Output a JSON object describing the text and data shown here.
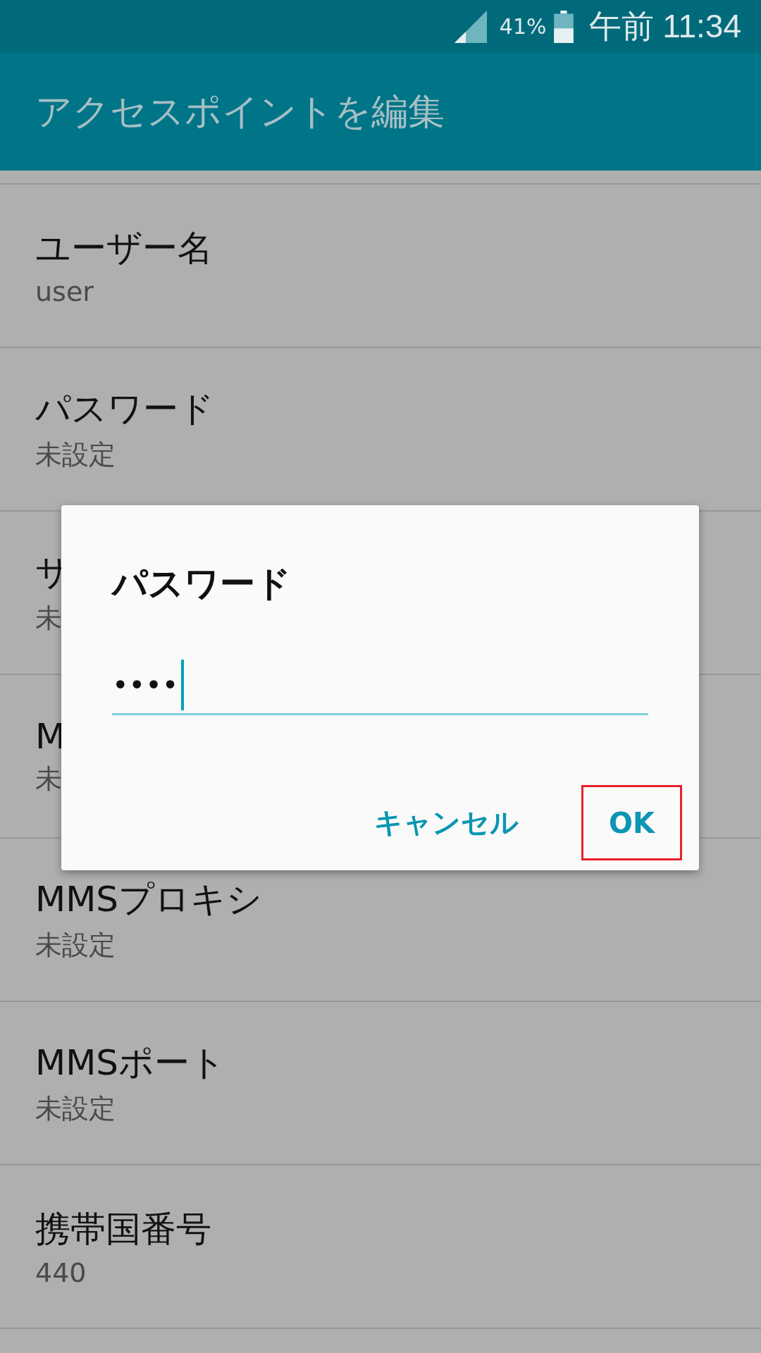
{
  "status_bar": {
    "battery": "41%",
    "time": "午前 11:34"
  },
  "app_bar": {
    "title": "アクセスポイントを編集"
  },
  "rows": [
    {
      "title": "ユーザー名",
      "value": "user"
    },
    {
      "title": "パスワード",
      "value": "未設定"
    },
    {
      "title": "サ",
      "value": "未"
    },
    {
      "title": "M",
      "value": "未"
    },
    {
      "title": "MMSプロキシ",
      "value": "未設定"
    },
    {
      "title": "MMSポート",
      "value": "未設定"
    },
    {
      "title": "携帯国番号",
      "value": "440"
    }
  ],
  "dialog": {
    "title": "パスワード",
    "field": {
      "value": "••••",
      "focused": true
    },
    "buttons": [
      {
        "label": "キャンセル",
        "highlighted": false
      },
      {
        "label": "OK",
        "highlighted": true
      }
    ]
  }
}
